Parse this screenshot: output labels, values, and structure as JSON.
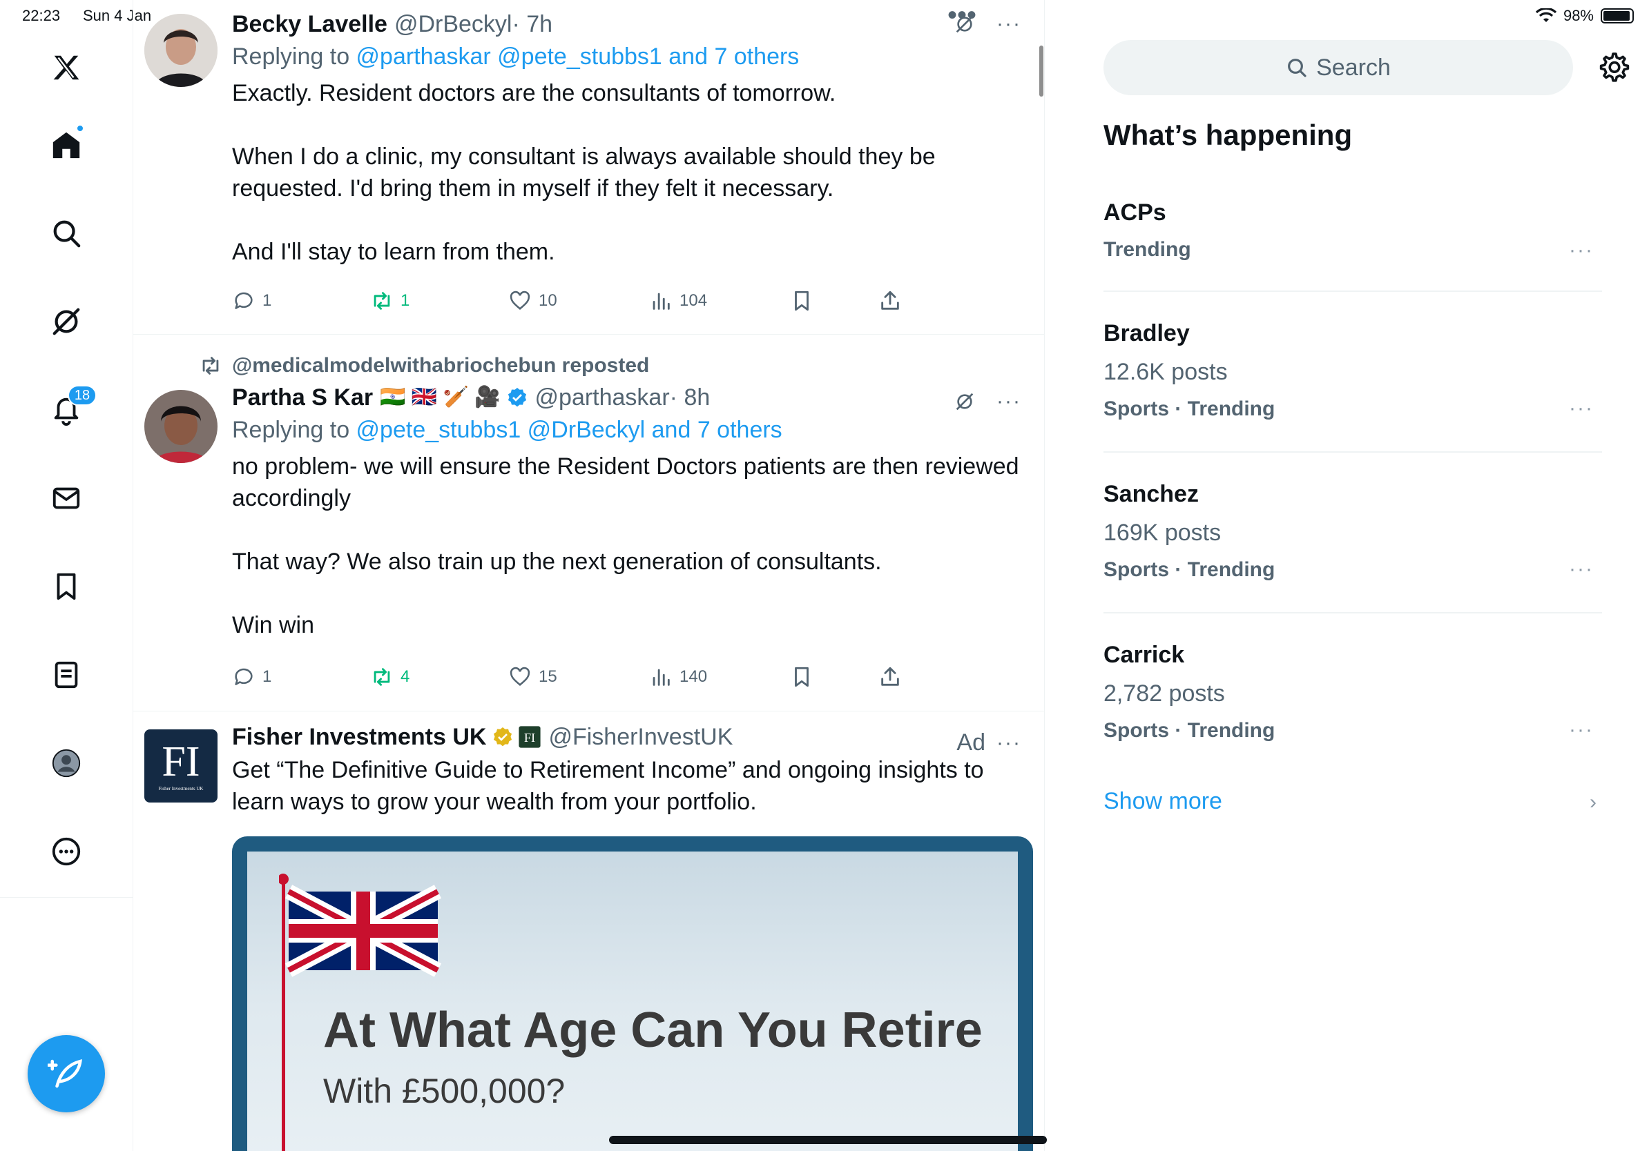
{
  "status": {
    "time": "22:23",
    "date": "Sun 4 Jan",
    "battery": "98%"
  },
  "nav": {
    "notifications_badge": "18"
  },
  "posts": [
    {
      "name": "Becky Lavelle",
      "handle": "@DrBeckyl",
      "time": "· 7h",
      "replying_prefix": "Replying to ",
      "replying_to": "@parthaskar @pete_stubbs1 and 7 others",
      "body": "Exactly. Resident doctors are the consultants of tomorrow.\n\nWhen I do a clinic, my consultant is always available should they be requested. I'd bring them in myself if they felt it necessary.\n\nAnd I'll stay to learn from them.",
      "replies": "1",
      "reposts": "1",
      "likes": "10",
      "views": "104"
    },
    {
      "reposted_by": "@medicalmodelwithabriochebun reposted",
      "name": "Partha S Kar",
      "flags": "🇮🇳 🇬🇧 🏏 🎥",
      "handle": "@parthaskar",
      "time": "· 8h",
      "replying_prefix": "Replying to ",
      "replying_to": "@pete_stubbs1 @DrBeckyl and 7 others",
      "body": "no problem- we will ensure the Resident Doctors patients are then reviewed accordingly\n\nThat way? We also train up the next generation of consultants.\n\nWin win",
      "replies": "1",
      "reposts": "4",
      "likes": "15",
      "views": "140"
    },
    {
      "name": "Fisher Investments UK",
      "logo_text": "FI",
      "logo_sub": "Fisher Investments UK",
      "handle": "@FisherInvestUK",
      "ad_label": "Ad",
      "body": "Get “The Definitive Guide to Retirement Income” and ongoing insights to learn ways to grow your wealth from your portfolio.",
      "card_title": "At What Age Can You Retire",
      "card_subtitle": "With £500,000?"
    }
  ],
  "search": {
    "placeholder": "Search"
  },
  "sidebar": {
    "title": "What’s happening",
    "trends": [
      {
        "name": "ACPs",
        "count": "",
        "meta": "Trending"
      },
      {
        "name": "Bradley",
        "count": "12.6K posts",
        "meta": "Sports · Trending"
      },
      {
        "name": "Sanchez",
        "count": "169K posts",
        "meta": "Sports · Trending"
      },
      {
        "name": "Carrick",
        "count": "2,782 posts",
        "meta": "Sports · Trending"
      }
    ],
    "show_more": "Show more"
  },
  "colors": {
    "accent": "#1d9bf0",
    "repost_green": "#00ba7c",
    "muted": "#536471"
  }
}
